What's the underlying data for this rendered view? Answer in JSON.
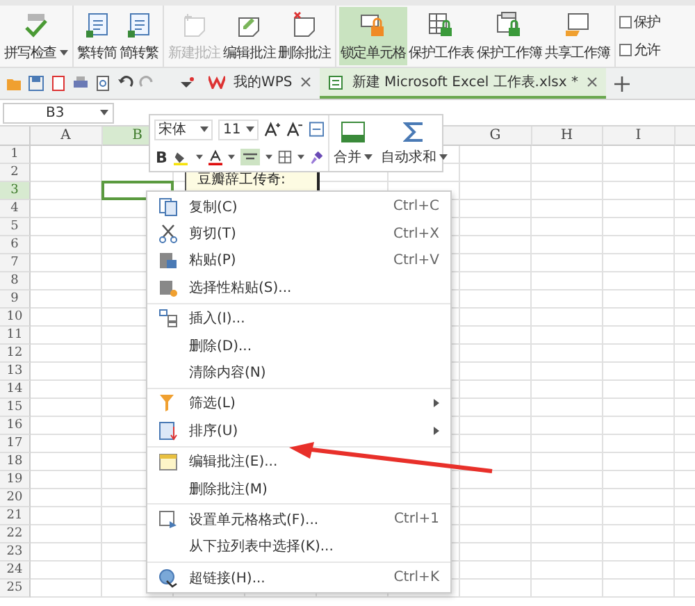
{
  "ribbon": {
    "groups": [
      {
        "items": [
          {
            "label": "拼写检查",
            "dropdown": true,
            "disabled": false,
            "selected": false
          }
        ]
      },
      {
        "items": [
          {
            "label": "繁转简",
            "dropdown": false,
            "disabled": false,
            "selected": false
          },
          {
            "label": "简转繁",
            "dropdown": false,
            "disabled": false,
            "selected": false
          }
        ]
      },
      {
        "items": [
          {
            "label": "新建批注",
            "dropdown": false,
            "disabled": true,
            "selected": false
          },
          {
            "label": "编辑批注",
            "dropdown": false,
            "disabled": false,
            "selected": false
          },
          {
            "label": "删除批注",
            "dropdown": false,
            "disabled": false,
            "selected": false
          }
        ]
      },
      {
        "items": [
          {
            "label": "锁定单元格",
            "dropdown": false,
            "disabled": false,
            "selected": true
          },
          {
            "label": "保护工作表",
            "dropdown": false,
            "disabled": false,
            "selected": false
          },
          {
            "label": "保护工作簿",
            "dropdown": false,
            "disabled": false,
            "selected": false
          },
          {
            "label": "共享工作簿",
            "dropdown": false,
            "disabled": false,
            "selected": false
          }
        ]
      }
    ],
    "small_items": [
      {
        "label": "保护"
      },
      {
        "label": "允许"
      }
    ]
  },
  "tabs": [
    {
      "label": "我的WPS",
      "selected": false
    },
    {
      "label": "新建 Microsoft Excel 工作表.xlsx *",
      "selected": true
    }
  ],
  "formula_bar": {
    "cell_name": "B3"
  },
  "sheet": {
    "columns_left": [
      {
        "label": "A",
        "selected": false
      },
      {
        "label": "B",
        "selected": true
      }
    ],
    "columns_right": [
      {
        "label": "G",
        "selected": false
      },
      {
        "label": "H",
        "selected": false
      },
      {
        "label": "I",
        "selected": false
      }
    ],
    "rows": [
      {
        "label": "1",
        "selected": false
      },
      {
        "label": "2",
        "selected": false
      },
      {
        "label": "3",
        "selected": true
      },
      {
        "label": "4",
        "selected": false
      },
      {
        "label": "5",
        "selected": false
      },
      {
        "label": "6",
        "selected": false
      },
      {
        "label": "7",
        "selected": false
      },
      {
        "label": "8",
        "selected": false
      },
      {
        "label": "9",
        "selected": false
      },
      {
        "label": "10",
        "selected": false
      },
      {
        "label": "11",
        "selected": false
      },
      {
        "label": "12",
        "selected": false
      },
      {
        "label": "13",
        "selected": false
      },
      {
        "label": "14",
        "selected": false
      },
      {
        "label": "15",
        "selected": false
      },
      {
        "label": "16",
        "selected": false
      },
      {
        "label": "17",
        "selected": false
      },
      {
        "label": "18",
        "selected": false
      },
      {
        "label": "19",
        "selected": false
      },
      {
        "label": "20",
        "selected": false
      },
      {
        "label": "21",
        "selected": false
      },
      {
        "label": "22",
        "selected": false
      },
      {
        "label": "23",
        "selected": false
      },
      {
        "label": "24",
        "selected": false
      },
      {
        "label": "25",
        "selected": false
      }
    ]
  },
  "mini_toolbar": {
    "font": "宋体",
    "size": "11",
    "bold": "B",
    "merge": "合并",
    "autosum": "自动求和"
  },
  "comment": {
    "text": "豆瓣辞工传奇:"
  },
  "context_menu": {
    "groups": [
      {
        "items": [
          {
            "label": "复制(C)",
            "shortcut": "Ctrl+C",
            "submenu": false
          },
          {
            "label": "剪切(T)",
            "shortcut": "Ctrl+X",
            "submenu": false
          },
          {
            "label": "粘贴(P)",
            "shortcut": "Ctrl+V",
            "submenu": false
          },
          {
            "label": "选择性粘贴(S)...",
            "submenu": false
          }
        ]
      },
      {
        "items": [
          {
            "label": "插入(I)...",
            "submenu": false
          },
          {
            "label": "删除(D)...",
            "submenu": false
          },
          {
            "label": "清除内容(N)",
            "submenu": false
          }
        ]
      },
      {
        "items": [
          {
            "label": "筛选(L)",
            "submenu": true
          },
          {
            "label": "排序(U)",
            "submenu": true
          }
        ]
      },
      {
        "items": [
          {
            "label": "编辑批注(E)...",
            "submenu": false
          },
          {
            "label": "删除批注(M)",
            "submenu": false
          }
        ]
      },
      {
        "items": [
          {
            "label": "设置单元格格式(F)...",
            "shortcut": "Ctrl+1",
            "submenu": false
          },
          {
            "label": "从下拉列表中选择(K)...",
            "submenu": false
          }
        ]
      },
      {
        "items": [
          {
            "label": "超链接(H)...",
            "shortcut": "Ctrl+K",
            "submenu": false
          }
        ]
      }
    ]
  }
}
